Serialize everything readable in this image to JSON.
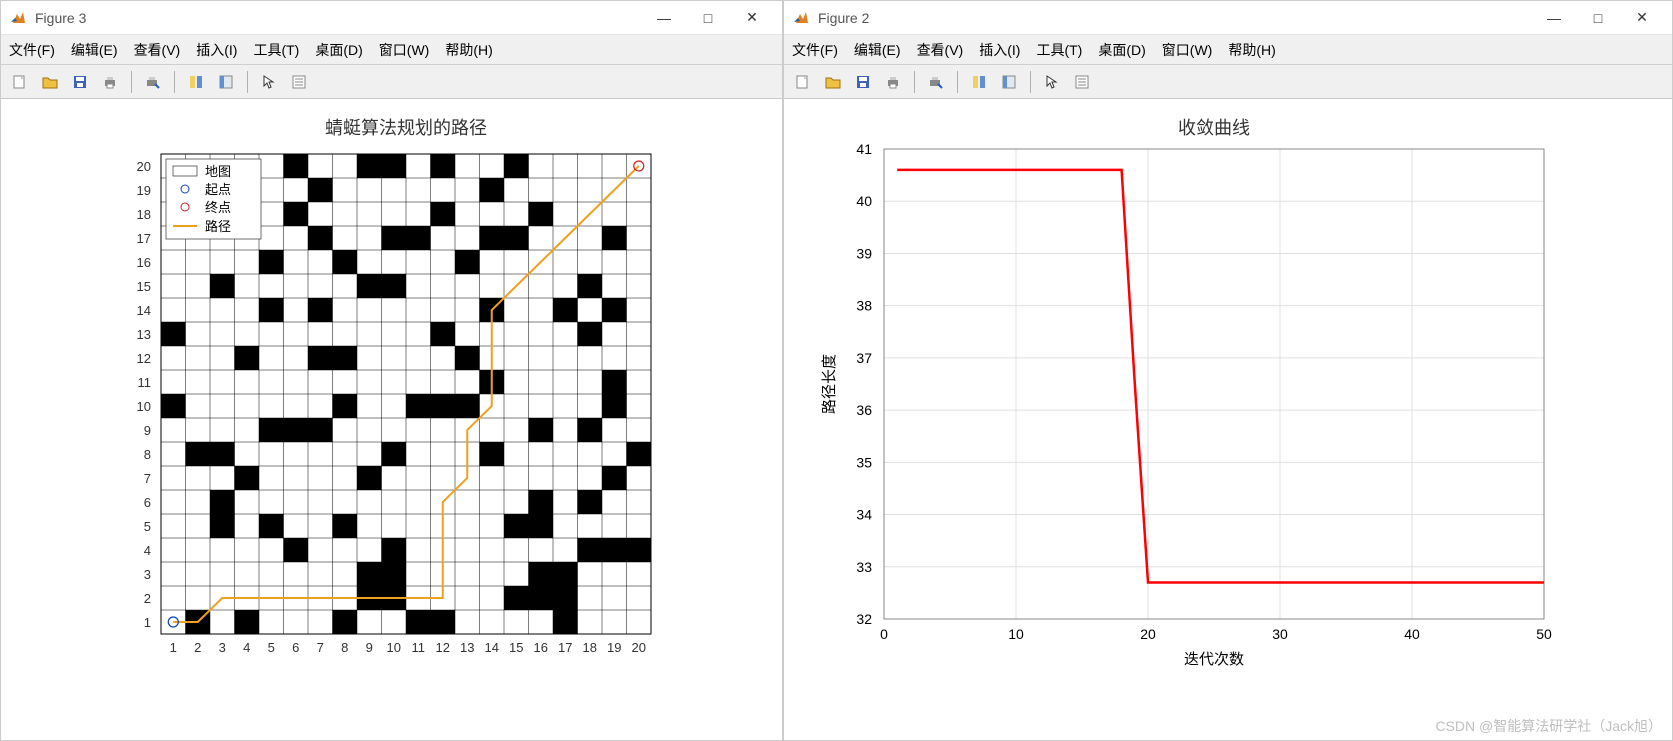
{
  "window3": {
    "title": "Figure 3",
    "minimize": "—",
    "maximize": "□",
    "close": "✕"
  },
  "window2": {
    "title": "Figure 2",
    "minimize": "—",
    "maximize": "□",
    "close": "✕"
  },
  "menu": {
    "file": "文件(F)",
    "edit": "编辑(E)",
    "view": "查看(V)",
    "insert": "插入(I)",
    "tools": "工具(T)",
    "desktop": "桌面(D)",
    "window": "窗口(W)",
    "help": "帮助(H)"
  },
  "chart_data": [
    {
      "type": "heatmap",
      "title": "蜻蜓算法规划的路径",
      "xlabel": "",
      "ylabel": "",
      "xlim": [
        1,
        20
      ],
      "ylim": [
        1,
        20
      ],
      "x_ticks": [
        1,
        2,
        3,
        4,
        5,
        6,
        7,
        8,
        9,
        10,
        11,
        12,
        13,
        14,
        15,
        16,
        17,
        18,
        19,
        20
      ],
      "y_ticks": [
        1,
        2,
        3,
        4,
        5,
        6,
        7,
        8,
        9,
        10,
        11,
        12,
        13,
        14,
        15,
        16,
        17,
        18,
        19,
        20
      ],
      "legend": [
        "地图",
        "起点",
        "终点",
        "路径"
      ],
      "start_point": [
        1,
        1
      ],
      "end_point": [
        20,
        20
      ],
      "obstacles": [
        [
          2,
          1
        ],
        [
          4,
          1
        ],
        [
          8,
          1
        ],
        [
          11,
          1
        ],
        [
          12,
          1
        ],
        [
          17,
          1
        ],
        [
          9,
          2
        ],
        [
          10,
          2
        ],
        [
          15,
          2
        ],
        [
          16,
          2
        ],
        [
          17,
          2
        ],
        [
          9,
          3
        ],
        [
          10,
          3
        ],
        [
          16,
          3
        ],
        [
          17,
          3
        ],
        [
          6,
          4
        ],
        [
          10,
          4
        ],
        [
          18,
          4
        ],
        [
          19,
          4
        ],
        [
          20,
          4
        ],
        [
          3,
          5
        ],
        [
          5,
          5
        ],
        [
          8,
          5
        ],
        [
          15,
          5
        ],
        [
          16,
          5
        ],
        [
          3,
          6
        ],
        [
          16,
          6
        ],
        [
          18,
          6
        ],
        [
          4,
          7
        ],
        [
          9,
          7
        ],
        [
          19,
          7
        ],
        [
          2,
          8
        ],
        [
          3,
          8
        ],
        [
          10,
          8
        ],
        [
          14,
          8
        ],
        [
          20,
          8
        ],
        [
          5,
          9
        ],
        [
          6,
          9
        ],
        [
          7,
          9
        ],
        [
          16,
          9
        ],
        [
          18,
          9
        ],
        [
          1,
          10
        ],
        [
          8,
          10
        ],
        [
          11,
          10
        ],
        [
          12,
          10
        ],
        [
          13,
          10
        ],
        [
          19,
          10
        ],
        [
          14,
          11
        ],
        [
          19,
          11
        ],
        [
          4,
          12
        ],
        [
          7,
          12
        ],
        [
          8,
          12
        ],
        [
          13,
          12
        ],
        [
          1,
          13
        ],
        [
          12,
          13
        ],
        [
          18,
          13
        ],
        [
          5,
          14
        ],
        [
          7,
          14
        ],
        [
          14,
          14
        ],
        [
          17,
          14
        ],
        [
          19,
          14
        ],
        [
          3,
          15
        ],
        [
          9,
          15
        ],
        [
          10,
          15
        ],
        [
          18,
          15
        ],
        [
          5,
          16
        ],
        [
          8,
          16
        ],
        [
          13,
          16
        ],
        [
          7,
          17
        ],
        [
          10,
          17
        ],
        [
          11,
          17
        ],
        [
          14,
          17
        ],
        [
          15,
          17
        ],
        [
          19,
          17
        ],
        [
          6,
          18
        ],
        [
          12,
          18
        ],
        [
          16,
          18
        ],
        [
          2,
          19
        ],
        [
          3,
          19
        ],
        [
          7,
          19
        ],
        [
          14,
          19
        ],
        [
          6,
          20
        ],
        [
          9,
          20
        ],
        [
          10,
          20
        ],
        [
          12,
          20
        ],
        [
          15,
          20
        ]
      ],
      "path": [
        [
          1,
          1
        ],
        [
          2,
          1
        ],
        [
          3,
          2
        ],
        [
          4,
          2
        ],
        [
          5,
          2
        ],
        [
          6,
          2
        ],
        [
          7,
          2
        ],
        [
          8,
          2
        ],
        [
          9,
          2
        ],
        [
          10,
          2
        ],
        [
          11,
          2
        ],
        [
          12,
          2
        ],
        [
          12,
          3
        ],
        [
          12,
          4
        ],
        [
          12,
          5
        ],
        [
          12,
          6
        ],
        [
          13,
          7
        ],
        [
          13,
          8
        ],
        [
          13,
          9
        ],
        [
          14,
          10
        ],
        [
          14,
          11
        ],
        [
          14,
          12
        ],
        [
          14,
          13
        ],
        [
          14,
          14
        ],
        [
          15,
          15
        ],
        [
          16,
          16
        ],
        [
          17,
          17
        ],
        [
          18,
          18
        ],
        [
          19,
          19
        ],
        [
          20,
          20
        ]
      ],
      "path_color": "#f0a020"
    },
    {
      "type": "line",
      "title": "收敛曲线",
      "xlabel": "迭代次数",
      "ylabel": "路径长度",
      "xlim": [
        0,
        50
      ],
      "ylim": [
        32,
        41
      ],
      "x_ticks": [
        0,
        10,
        20,
        30,
        40,
        50
      ],
      "y_ticks": [
        32,
        33,
        34,
        35,
        36,
        37,
        38,
        39,
        40,
        41
      ],
      "x": [
        1,
        5,
        10,
        15,
        17,
        18,
        19,
        20,
        25,
        30,
        35,
        40,
        45,
        50
      ],
      "values": [
        40.6,
        40.6,
        40.6,
        40.6,
        40.6,
        40.6,
        36.5,
        32.7,
        32.7,
        32.7,
        32.7,
        32.7,
        32.7,
        32.7
      ],
      "line_color": "#ff0000"
    }
  ],
  "watermark": "CSDN @智能算法研学社（Jack旭）"
}
